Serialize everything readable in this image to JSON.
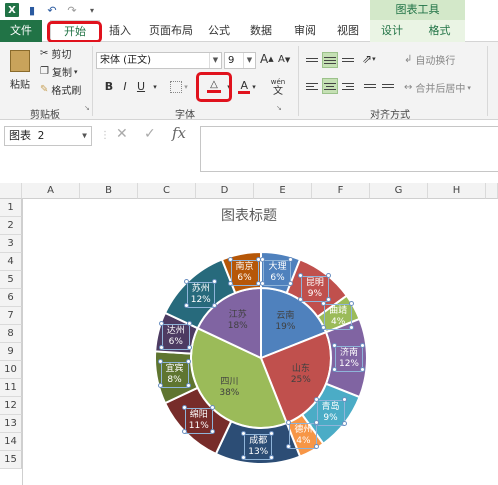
{
  "qat": {
    "save_icon": "save-icon",
    "undo_icon": "undo-icon",
    "redo_icon": "redo-icon"
  },
  "context_group": "图表工具",
  "tabs": {
    "file": "文件",
    "home": "开始",
    "insert": "插入",
    "layout": "页面布局",
    "formulas": "公式",
    "data": "数据",
    "review": "审阅",
    "view": "视图",
    "design": "设计",
    "format": "格式"
  },
  "clipboard": {
    "paste": "粘贴",
    "cut": "剪切",
    "copy": "复制",
    "format_painter": "格式刷",
    "group": "剪贴板"
  },
  "font": {
    "name": "宋体 (正文)",
    "size": "9",
    "bold": "B",
    "italic": "I",
    "underline": "U",
    "grow": "A",
    "shrink": "A",
    "group": "字体",
    "wen": "wén",
    "wen_char": "文"
  },
  "alignment": {
    "wrap": "自动换行",
    "merge": "合并后居中",
    "group": "对齐方式"
  },
  "formula_bar": {
    "namebox": "图表 2",
    "cancel": "✕",
    "enter": "✓",
    "fx": "fx"
  },
  "columns": [
    "A",
    "B",
    "C",
    "D",
    "E",
    "F",
    "G",
    "H"
  ],
  "rows": [
    "1",
    "2",
    "3",
    "4",
    "5",
    "6",
    "7",
    "8",
    "9",
    "10",
    "11",
    "12",
    "13",
    "14",
    "15"
  ],
  "chart": {
    "title": "图表标题"
  },
  "chart_data": {
    "type": "pie",
    "title": "图表标题",
    "inner": [
      {
        "name": "云南",
        "pct": "19%",
        "value": 19,
        "color": "#4f81bd"
      },
      {
        "name": "山东",
        "pct": "25%",
        "value": 25,
        "color": "#c0504d"
      },
      {
        "name": "四川",
        "pct": "38%",
        "value": 38,
        "color": "#9bbb59"
      },
      {
        "name": "江苏",
        "pct": "18%",
        "value": 18,
        "color": "#8064a2"
      }
    ],
    "outer": [
      {
        "name": "大理",
        "pct": "6%",
        "value": 6,
        "color": "#4f81bd"
      },
      {
        "name": "昆明",
        "pct": "9%",
        "value": 9,
        "color": "#c0504d"
      },
      {
        "name": "曲靖",
        "pct": "4%",
        "value": 4,
        "color": "#9bbb59"
      },
      {
        "name": "济南",
        "pct": "12%",
        "value": 12,
        "color": "#8064a2"
      },
      {
        "name": "青岛",
        "pct": "9%",
        "value": 9,
        "color": "#4bacc6"
      },
      {
        "name": "德州",
        "pct": "4%",
        "value": 4,
        "color": "#f79646"
      },
      {
        "name": "成都",
        "pct": "13%",
        "value": 13,
        "color": "#2c4d75"
      },
      {
        "name": "绵阳",
        "pct": "11%",
        "value": 11,
        "color": "#772c2a"
      },
      {
        "name": "宜宾",
        "pct": "8%",
        "value": 8,
        "color": "#5f7530"
      },
      {
        "name": "达州",
        "pct": "6%",
        "value": 6,
        "color": "#4d3b62"
      },
      {
        "name": "苏州",
        "pct": "12%",
        "value": 12,
        "color": "#276a7c"
      },
      {
        "name": "南京",
        "pct": "6%",
        "value": 6,
        "color": "#b65708"
      }
    ]
  }
}
